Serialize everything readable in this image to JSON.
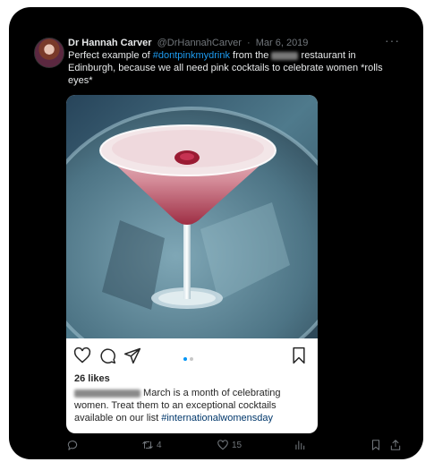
{
  "tweet": {
    "author_name": "Dr Hannah Carver",
    "author_handle": "@DrHannahCarver",
    "separator": "·",
    "date": "Mar 6, 2019",
    "text_before": "Perfect example of ",
    "hashtag": "#dontpinkmydrink",
    "text_middle": " from the ",
    "text_after": " restaurant in Edinburgh, because we all need pink cocktails to celebrate women *rolls eyes*",
    "more_label": "···"
  },
  "embed": {
    "likes": "26 likes",
    "caption_text": " March is a month of celebrating women. Treat them to an exceptional cocktails available on our list ",
    "caption_hashtag": "#internationalwomensday",
    "carousel_dots": 2,
    "active_dot": 0
  },
  "footer": {
    "reply_count": "",
    "retweet_count": "4",
    "like_count": "15"
  },
  "colors": {
    "background": "#000000",
    "text": "#e7e9ea",
    "muted": "#71767b",
    "link": "#1d9bf0",
    "ig_active_dot": "#0095f6"
  },
  "icons": [
    "heart-icon",
    "comment-icon",
    "share-icon",
    "bookmark-icon",
    "reply-icon",
    "retweet-icon",
    "like-icon",
    "views-icon",
    "tweet-bookmark-icon",
    "tweet-share-icon"
  ]
}
